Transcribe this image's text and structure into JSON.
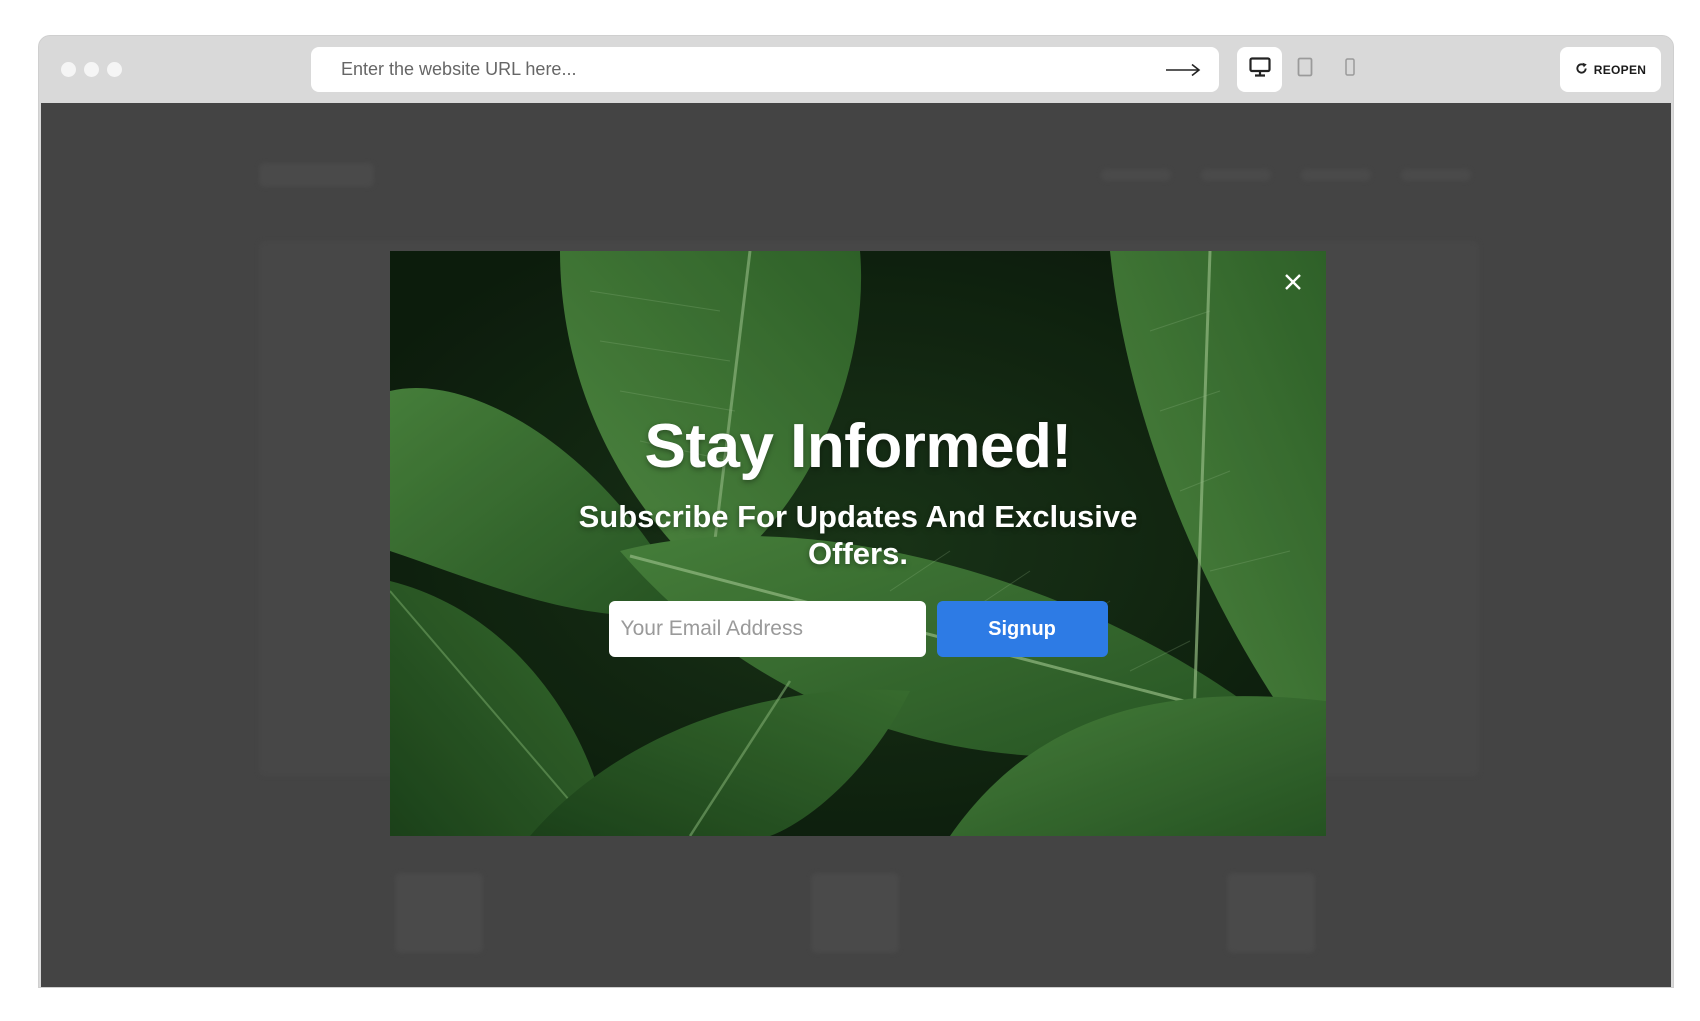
{
  "toolbar": {
    "url_placeholder": "Enter the website URL here...",
    "reopen_label": "REOPEN",
    "devices": [
      "desktop-icon",
      "tablet-icon",
      "mobile-icon"
    ]
  },
  "popup": {
    "title": "Stay Informed!",
    "subtitle": "Subscribe For Updates And Exclusive Offers.",
    "email_placeholder": "Your Email Address",
    "signup_label": "Signup"
  },
  "colors": {
    "overlay": "#444444",
    "signup_button": "#2d7be5",
    "toolbar": "#d9d9d9"
  }
}
